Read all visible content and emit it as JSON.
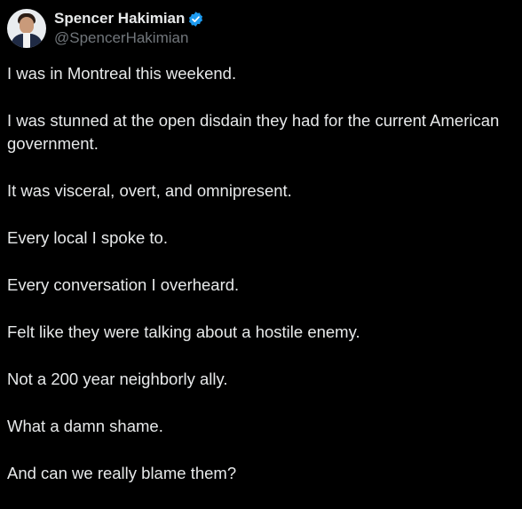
{
  "author": {
    "display_name": "Spencer Hakimian",
    "handle": "@SpencerHakimian",
    "verified": true,
    "avatar_icon": "profile-photo"
  },
  "colors": {
    "background": "#000000",
    "text": "#e7e9ea",
    "secondary_text": "#71767b",
    "verified_badge": "#1d9bf0"
  },
  "tweet": {
    "paragraphs": [
      "I was in Montreal this weekend.",
      "I was stunned at the open disdain they had for the current American government.",
      "It was visceral, overt, and omnipresent.",
      "Every local I spoke to.",
      "Every conversation I overheard.",
      "Felt like they were talking about a hostile enemy.",
      "Not a 200 year neighborly ally.",
      "What a damn shame.",
      "And can we really blame them?"
    ]
  }
}
